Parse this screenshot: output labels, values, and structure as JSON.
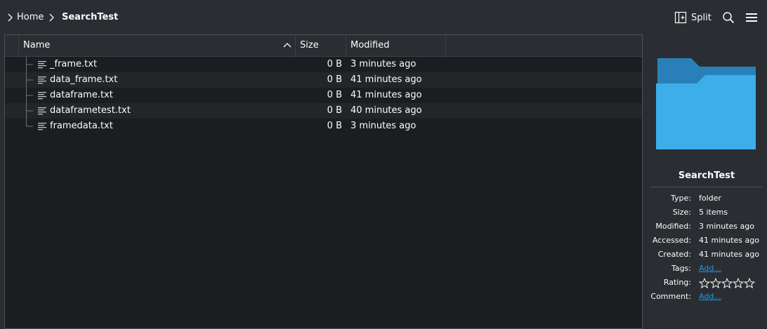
{
  "breadcrumb": {
    "items": [
      "Home",
      "SearchTest"
    ]
  },
  "toolbar": {
    "split_label": "Split"
  },
  "columns": {
    "name": "Name",
    "size": "Size",
    "modified": "Modified"
  },
  "files": [
    {
      "name": "_frame.txt",
      "size": "0 B",
      "modified": "3 minutes ago"
    },
    {
      "name": "data_frame.txt",
      "size": "0 B",
      "modified": "41 minutes ago"
    },
    {
      "name": "dataframe.txt",
      "size": "0 B",
      "modified": "41 minutes ago"
    },
    {
      "name": "dataframetest.txt",
      "size": "0 B",
      "modified": "40 minutes ago"
    },
    {
      "name": "framedata.txt",
      "size": "0 B",
      "modified": "3 minutes ago"
    }
  ],
  "info_panel": {
    "title": "SearchTest",
    "fields": [
      {
        "label": "Type:",
        "value": "folder"
      },
      {
        "label": "Size:",
        "value": "5 items"
      },
      {
        "label": "Modified:",
        "value": "3 minutes ago"
      },
      {
        "label": "Accessed:",
        "value": "41 minutes ago"
      },
      {
        "label": "Created:",
        "value": "41 minutes ago"
      },
      {
        "label": "Tags:",
        "value": "Add..."
      },
      {
        "label": "Rating:",
        "value": ""
      },
      {
        "label": "Comment:",
        "value": "Add..."
      }
    ],
    "rating_stars_filled": 0,
    "rating_stars_total": 5
  },
  "colors": {
    "accent": "#1d99f3",
    "folder_front": "#3daee9",
    "folder_back": "#2980b9",
    "window_bg": "#2a2e32",
    "view_bg": "#1b1e20"
  }
}
